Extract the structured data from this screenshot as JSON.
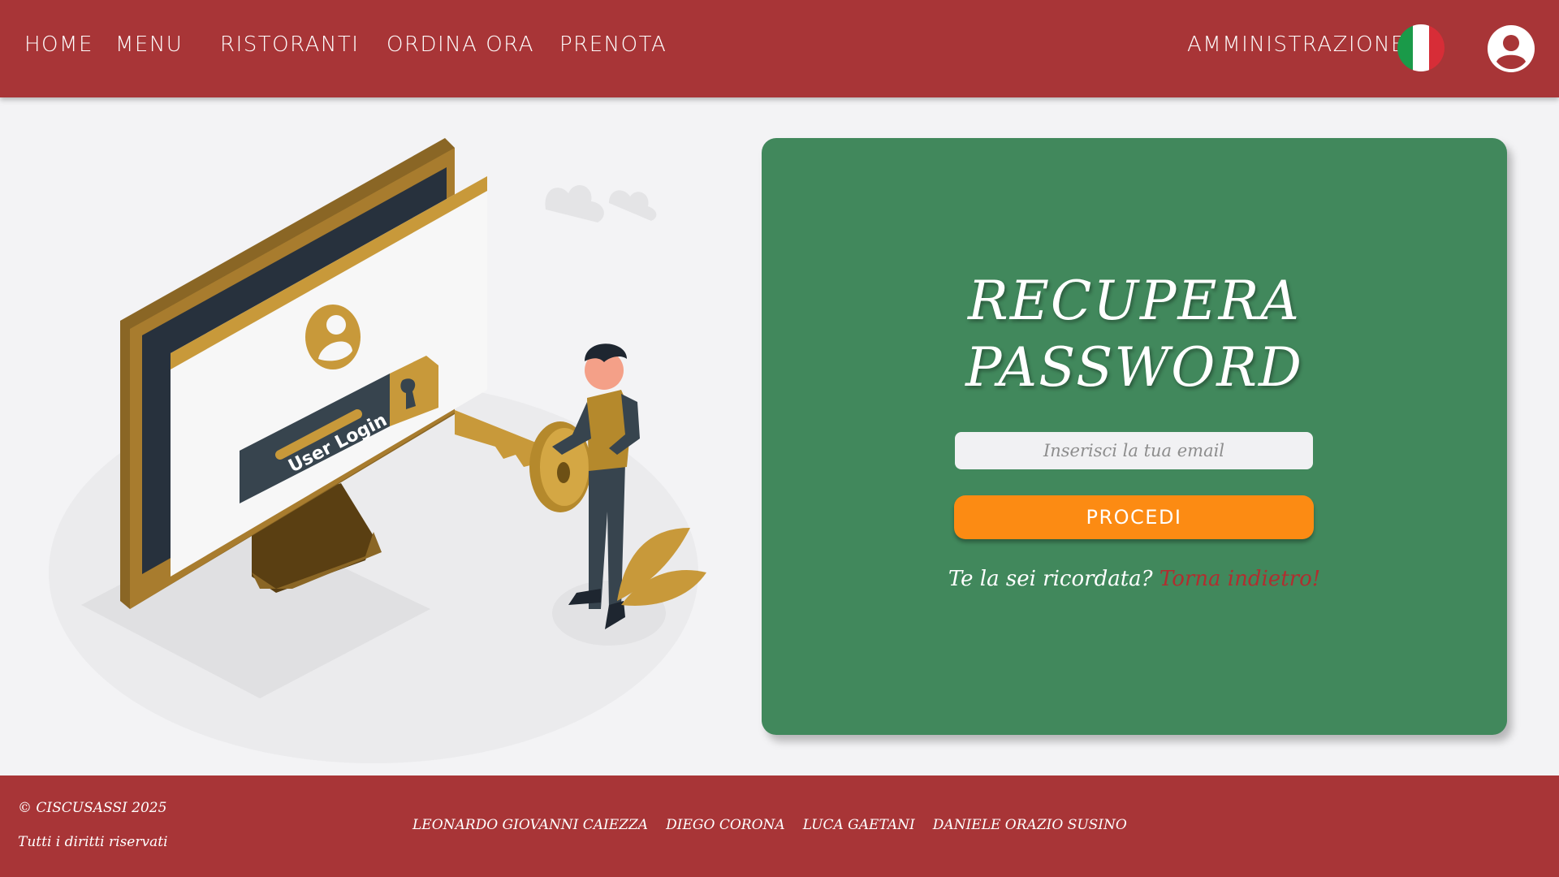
{
  "nav": {
    "home": "HOME",
    "menu": "MENU",
    "restaurants": "RISTORANTI",
    "order": "ORDINA ORA",
    "book": "PRENOTA",
    "admin": "AMMINISTRAZIONE",
    "flag_icon": "italian-flag-icon",
    "user_icon": "user-account-icon"
  },
  "illustration": {
    "login_label": "User Login"
  },
  "card": {
    "title_line1": "RECUPERA",
    "title_line2": "PASSWORD",
    "email_placeholder": "Inserisci la tua email",
    "email_value": "",
    "proceed_label": "PROCEDI",
    "remember_text": "Te la sei ricordata?",
    "back_link": "Torna indietro!"
  },
  "footer": {
    "copyright": "© CISCUSASSI 2025",
    "rights": "Tutti i diritti riservati",
    "authors": [
      "LEONARDO GIOVANNI CAIEZZA",
      "DIEGO CORONA",
      "LUCA GAETANI",
      "DANIELE ORAZIO SUSINO"
    ]
  },
  "colors": {
    "brand_red": "#a83537",
    "card_green": "#41885c",
    "button_orange": "#fc8b13",
    "link_red": "#b02e2f",
    "page_bg": "#f3f3f5"
  }
}
